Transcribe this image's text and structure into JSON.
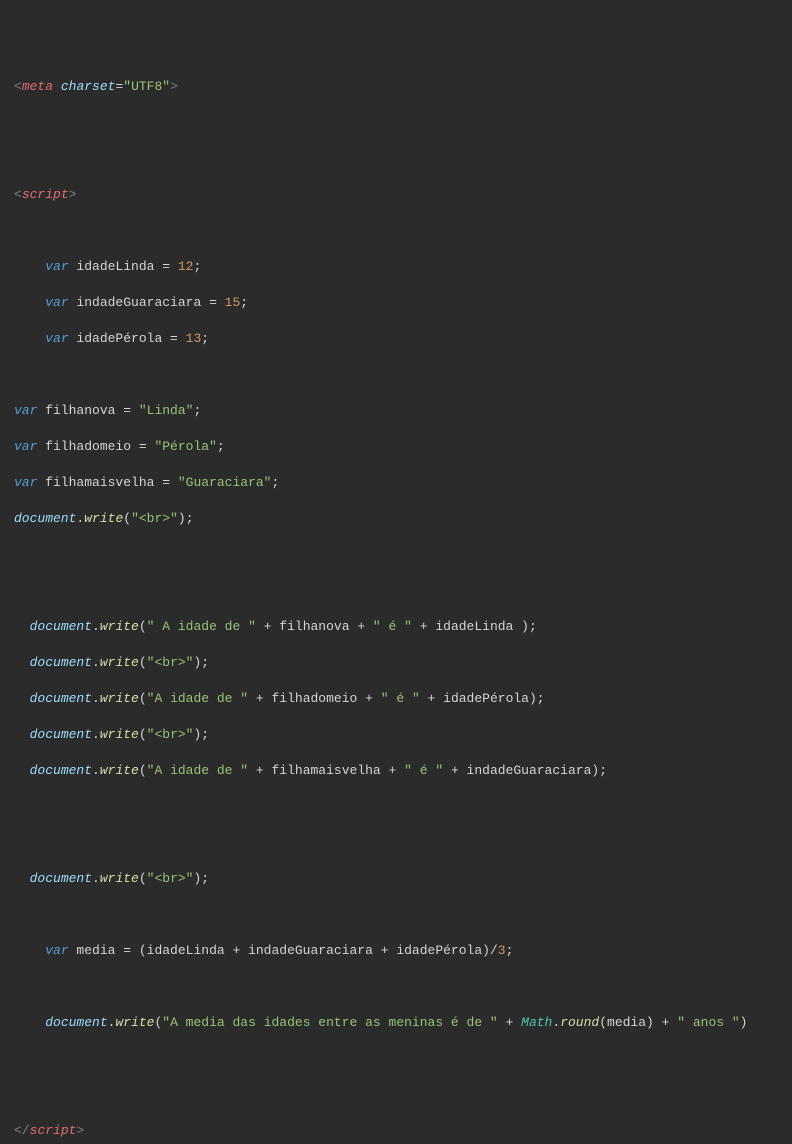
{
  "code": {
    "meta_open": "<",
    "meta_name": "meta",
    "meta_attr": "charset",
    "meta_eq": "=",
    "meta_val": "\"UTF8\"",
    "meta_close": ">",
    "script_open1": "<",
    "script_name": "script",
    "script_close1": ">",
    "var_kw": "var",
    "idadeLinda": " idadeLinda ",
    "eq": "= ",
    "num12": "12",
    "semi": ";",
    "indadeGuaraciara": " indadeGuaraciara ",
    "num15": "15",
    "idadePerola": " idadePérola ",
    "num13": "13",
    "filhanova": " filhanova ",
    "str_linda": "\"Linda\"",
    "filhadomeio": " filhadomeio ",
    "str_perola": "\"Pérola\"",
    "filhamaisvelha": " filhamaisvelha ",
    "str_guaraciara": "\"Guaraciara\"",
    "document": "document",
    "dot": ".",
    "write": "write",
    "lparen": "(",
    "rparen": ")",
    "str_br": "\"<br>\"",
    "str_aidade": "\" A idade de \"",
    "str_aidade2": "\"A idade de \"",
    "plus": " + ",
    "filhanova_ref": "filhanova",
    "str_e": "\" é \"",
    "idadeLinda_ref": "idadeLinda ",
    "filhadomeio_ref": "filhadomeio",
    "idadePerola_ref": "idadePérola",
    "filhamaisvelha_ref": "filhamaisvelha",
    "indadeGuaraciara_ref": "indadeGuaraciara",
    "media": " media ",
    "media_ref": "media",
    "lparen2": "(",
    "idadeLinda_ref2": "idadeLinda",
    "indadeGuaraciara_ref2": "indadeGuaraciara",
    "idadePerola_ref2": "idadePérola",
    "rparen2": ")",
    "slash": "/",
    "num3": "3",
    "str_media": "\"A media das idades entre as meninas é de \"",
    "math": "Math",
    "round": "round",
    "str_anos": "\" anos \"",
    "script_open2": "</",
    "script_close2": ">"
  }
}
